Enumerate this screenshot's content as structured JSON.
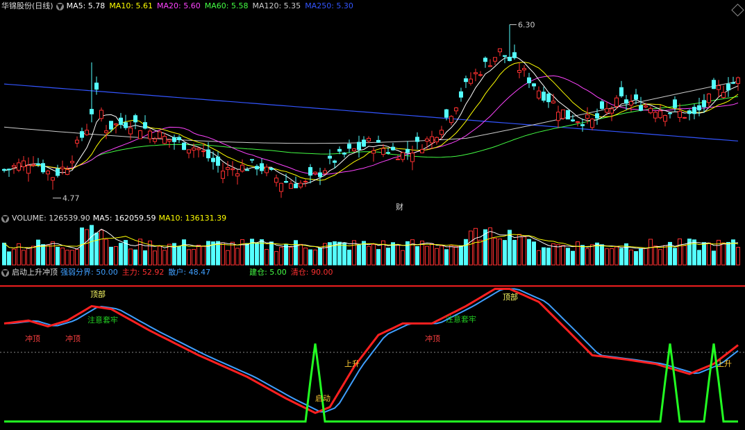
{
  "price_header": {
    "title": "华锦股份(日线)",
    "ma": [
      {
        "label": "MA5: 5.78",
        "color": "#ffffff"
      },
      {
        "label": "MA10: 5.61",
        "color": "#ffff00"
      },
      {
        "label": "MA20: 5.60",
        "color": "#ff44ff"
      },
      {
        "label": "MA60: 5.58",
        "color": "#44ff44"
      },
      {
        "label": "MA120: 5.35",
        "color": "#cccccc"
      },
      {
        "label": "MA250: 5.30",
        "color": "#3355ff"
      }
    ]
  },
  "price_annotations": {
    "high": "6.30",
    "low": "4.77",
    "marker": "财"
  },
  "volume_header": {
    "title": "VOLUME: 126539.90",
    "ma5": "MA5: 162059.59",
    "ma10": "MA10: 136131.39"
  },
  "indicator_header": {
    "title": "启动上升冲顶",
    "items": [
      {
        "label": "强弱分界: 50.00",
        "color": "#3f9fff"
      },
      {
        "label": "主力: 52.92",
        "color": "#ff3030"
      },
      {
        "label": "散户: 48.47",
        "color": "#3f9fff"
      },
      {
        "label": "建仓: 5.00",
        "color": "#44ff44"
      },
      {
        "label": "清仓: 90.00",
        "color": "#ff3030"
      }
    ]
  },
  "indicator_labels": {
    "chongding": "冲顶",
    "dingbu": "顶部",
    "zhuyi": "注意套牢",
    "shangsheng": "上升",
    "qidong": "启动"
  },
  "colors": {
    "up": "#ff3030",
    "down": "#54ffff",
    "ma5": "#ffffff",
    "ma10": "#ffff00",
    "ma20": "#ff44ff",
    "ma60": "#44ff44",
    "ma120": "#cccccc",
    "ma250": "#3355ff"
  },
  "chart_data": [
    {
      "type": "candlestick",
      "ylim": [
        4.6,
        6.4
      ],
      "series": [
        {
          "name": "华锦股份(日线)"
        }
      ]
    },
    {
      "type": "bar",
      "series": [
        {
          "name": "VOLUME"
        }
      ]
    },
    {
      "type": "line",
      "series": [
        {
          "name": "主力"
        },
        {
          "name": "散户"
        },
        {
          "name": "建仓"
        }
      ],
      "ylim": [
        0,
        100
      ]
    }
  ]
}
